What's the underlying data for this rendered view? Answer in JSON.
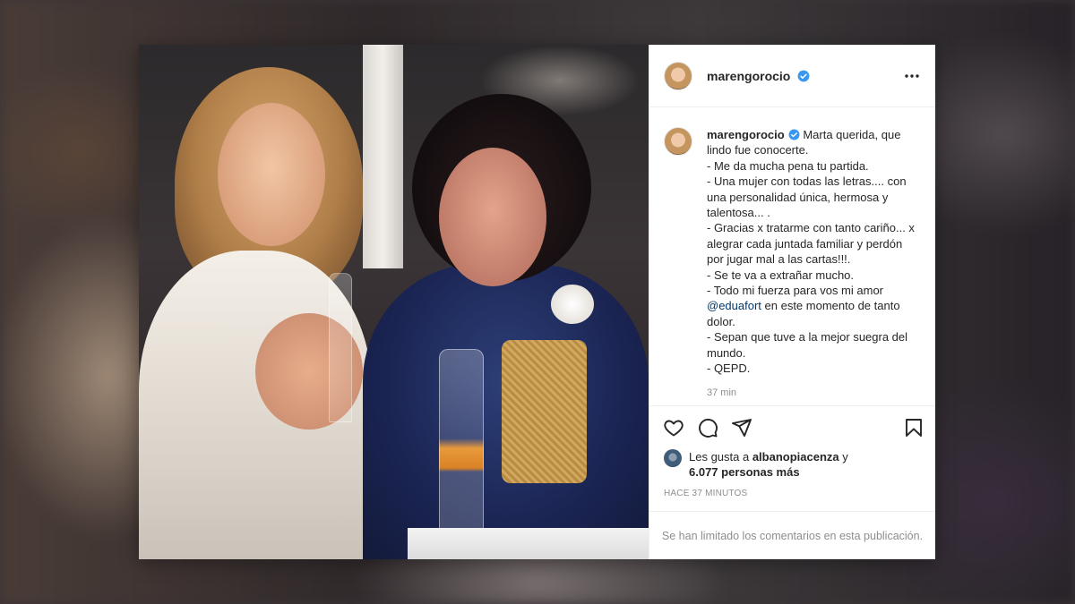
{
  "post": {
    "username": "marengorocio",
    "caption": {
      "lines": [
        "Marta querida, que lindo fue conocerte.",
        "- Me da mucha pena tu partida.",
        "- Una mujer con todas las letras.... con una personalidad única, hermosa y talentosa... .",
        "- Gracias x tratarme con tanto cariño... x alegrar cada juntada familiar y perdón por jugar mal a las cartas!!!.",
        "- Se te va a extrañar mucho.",
        "- Todo mi fuerza para vos mi amor"
      ],
      "mention": "@eduafort",
      "after_mention": " en este momento de tanto dolor.",
      "tail_lines": [
        "- Sepan que tuve a la mejor suegra del mundo.",
        "- QEPD."
      ]
    },
    "caption_time": "37 min",
    "likes": {
      "prefix": "Les gusta a ",
      "user": "albanopiacenza",
      "conjunction": " y",
      "others": "6.077 personas más"
    },
    "posted_ago": "HACE 37 MINUTOS",
    "comments_notice": "Se han limitado los comentarios en esta publicación."
  },
  "icons": {
    "verified": "verified-badge-icon",
    "more": "more-options-icon",
    "like": "heart-icon",
    "comment": "comment-icon",
    "share": "share-icon",
    "save": "bookmark-icon"
  },
  "colors": {
    "verified": "#3897f0",
    "text": "#262626",
    "secondary": "#8e8e8e",
    "mention": "#00376b"
  }
}
